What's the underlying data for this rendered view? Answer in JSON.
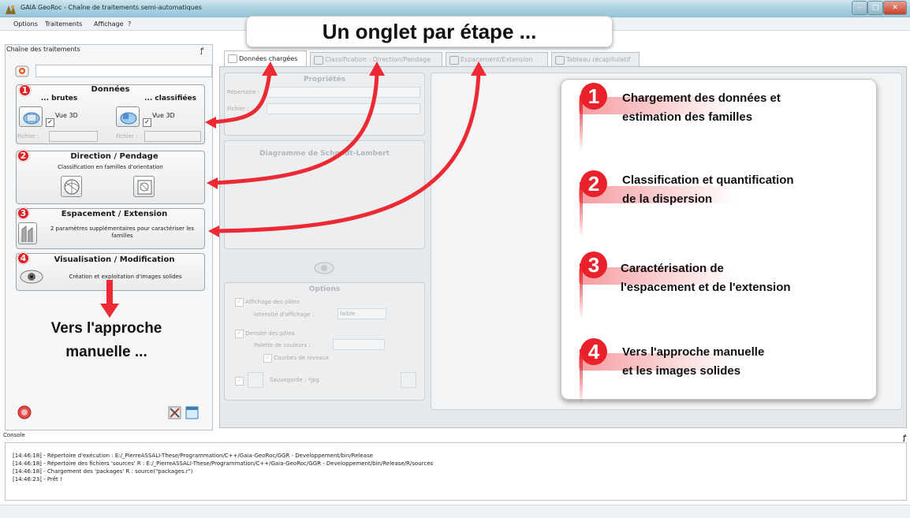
{
  "window": {
    "title": "GAIA GeoRoc - Chaîne de traitements semi-automatiques",
    "buttons": [
      "‒",
      "□",
      "✕"
    ]
  },
  "menu": [
    "Options",
    "Traitements",
    "Affichage",
    "?"
  ],
  "left_dock": {
    "title": "Chaîne des traitements",
    "donnees": {
      "title": "Données",
      "brutes": "... brutes",
      "classifiees": "... classifiées",
      "vue3d": "Vue 3D",
      "fichier": "Fichier :"
    },
    "direction": {
      "title": "Direction / Pendage",
      "desc": "Classification en familles d'orientation"
    },
    "espacement": {
      "title": "Espacement / Extension",
      "desc": "2 paramètres supplémentaires pour caractériser les familles"
    },
    "visualisation": {
      "title": "Visualisation / Modification",
      "desc": "Création et exploitation d'images solides"
    }
  },
  "tabs": [
    "Données chargées",
    "Classification : Direction/Pendage",
    "Espacement/Extension",
    "Tableau récapitulatif"
  ],
  "content": {
    "proprietes": "Propriétés",
    "repertoire": "Répertoire :",
    "fichier": "Fichier :",
    "diagramme": "Diagramme de Schmidt-Lambert",
    "options": "Options",
    "affichage_poles": "Affichage des pôles",
    "intensite": "Intensité d'affichage :",
    "intensite_value": "faible",
    "densite_poles": "Densité des pôles",
    "palette": "Palette de couleurs :",
    "courbes": "Courbes de niveaux",
    "sauvegarde": "Sauvegarde : *jpg"
  },
  "callouts": {
    "banner": "Un onglet par étape ...",
    "manual": [
      "Vers l'approche",
      "manuelle ..."
    ],
    "steps": [
      {
        "num": "1",
        "lines": [
          "Chargement des données et",
          "estimation des familles"
        ]
      },
      {
        "num": "2",
        "lines": [
          "Classification et quantification",
          "de la dispersion"
        ]
      },
      {
        "num": "3",
        "lines": [
          "Caractérisation de",
          "l'espacement et de l'extension"
        ]
      },
      {
        "num": "4",
        "lines": [
          "Vers l'approche manuelle",
          "et les images solides"
        ]
      }
    ]
  },
  "console": {
    "title": "Console",
    "lines": [
      "[14:46:18] - Répertoire d'exécution : E:/_PierreASSALI-These/Programmation/C++/Gaia-GeoRoc/GGR - Developpement/bin/Release",
      "[14:46:18] - Répertoire des fichiers 'sources' R : E:/_PierreASSALI-These/Programmation/C++/Gaia-GeoRoc/GGR - Developpement/bin/Release/R/sources",
      "[14:46:18] - Chargement des 'packages' R : source(\"packages.r\")",
      "[14:46:23] - Prêt !"
    ]
  },
  "colors": {
    "accent_red": "#e9212a",
    "titlebar": "#a9d0e0"
  }
}
